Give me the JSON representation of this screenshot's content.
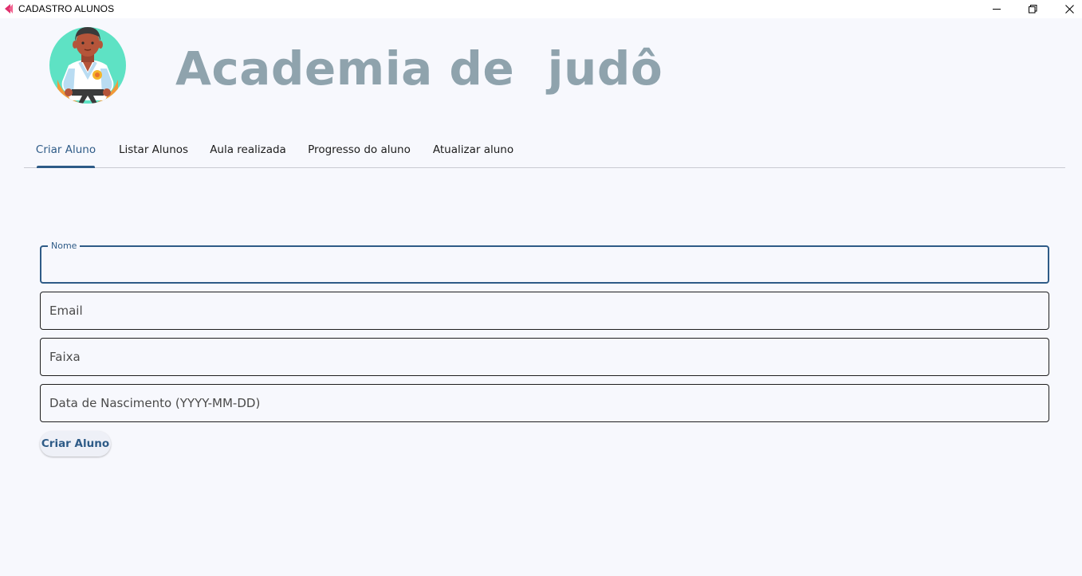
{
  "window": {
    "title": "CADASTRO ALUNOS",
    "minimize_icon": "minimize-icon",
    "maximize_icon": "restore-icon",
    "close_icon": "close-icon"
  },
  "header": {
    "logo_icon": "judoka-avatar-icon",
    "title": "Academia de  judô"
  },
  "tabs": [
    {
      "label": "Criar Aluno",
      "active": true
    },
    {
      "label": "Listar Alunos",
      "active": false
    },
    {
      "label": "Aula realizada",
      "active": false
    },
    {
      "label": "Progresso do aluno",
      "active": false
    },
    {
      "label": "Atualizar aluno",
      "active": false
    }
  ],
  "form": {
    "nome": {
      "label": "Nome",
      "value": "",
      "placeholder": ""
    },
    "email": {
      "value": "",
      "placeholder": "Email"
    },
    "faixa": {
      "value": "",
      "placeholder": "Faixa"
    },
    "data_nascimento": {
      "value": "",
      "placeholder": "Data de Nascimento (YYYY-MM-DD)"
    },
    "submit_label": "Criar Aluno"
  },
  "colors": {
    "accent": "#2e5b87",
    "title": "#8fa3ad",
    "background": "#f7f8fd"
  }
}
